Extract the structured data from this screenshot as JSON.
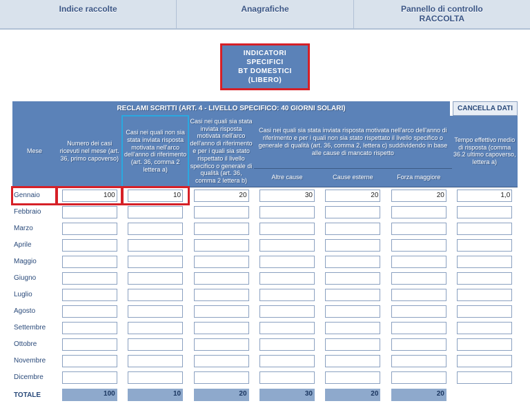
{
  "topbar": {
    "items": [
      "Indice raccolte",
      "Anagrafiche",
      "Pannello di controllo\nRACCOLTA"
    ]
  },
  "indicator_banner": {
    "line1": "INDICATORI SPECIFICI",
    "line2": "BT DOMESTICI (LIBERO)"
  },
  "title": "RECLAMI SCRITTI (ART. 4 - LIVELLO SPECIFICO: 40 GIORNI SOLARI)",
  "cancel_label": "CANCELLA DATI",
  "headers": {
    "mese": "Mese",
    "col1": "Numero dei casi ricevuti nel mese (art. 36, primo capoverso)",
    "col2": "Casi nei quali non sia stata inviata risposta motivata nell'arco dell'anno di riferimento (art. 36, comma 2 lettera a)",
    "col3": "Casi nei quali sia stata inviata risposta motivata nell'arco dell'anno di riferimento e per i quali sia stato rispettato il livello specifico o generale di qualità (art. 36, comma 2 lettera b)",
    "group4": "Casi nei quali sia stata inviata risposta motivata nell'arco dell'anno di riferimento e per i quali non sia stato rispettato il livello specifico o generale di qualità (art. 36, comma 2, lettera c) suddividendo in base alle cause di mancato rispetto",
    "col4a": "Altre cause",
    "col4b": "Cause esterne",
    "col4c": "Forza maggiore",
    "col5": "Tempo effettivo medio di risposta (comma 36.2 ultimo capoverso, lettera a)"
  },
  "months": [
    "Gennaio",
    "Febbraio",
    "Marzo",
    "Aprile",
    "Maggio",
    "Giugno",
    "Luglio",
    "Agosto",
    "Settembre",
    "Ottobre",
    "Novembre",
    "Dicembre"
  ],
  "rows": [
    {
      "v": [
        "100",
        "10",
        "20",
        "30",
        "20",
        "20",
        "1,0"
      ]
    },
    {
      "v": [
        "",
        "",
        "",
        "",
        "",
        "",
        ""
      ]
    },
    {
      "v": [
        "",
        "",
        "",
        "",
        "",
        "",
        ""
      ]
    },
    {
      "v": [
        "",
        "",
        "",
        "",
        "",
        "",
        ""
      ]
    },
    {
      "v": [
        "",
        "",
        "",
        "",
        "",
        "",
        ""
      ]
    },
    {
      "v": [
        "",
        "",
        "",
        "",
        "",
        "",
        ""
      ]
    },
    {
      "v": [
        "",
        "",
        "",
        "",
        "",
        "",
        ""
      ]
    },
    {
      "v": [
        "",
        "",
        "",
        "",
        "",
        "",
        ""
      ]
    },
    {
      "v": [
        "",
        "",
        "",
        "",
        "",
        "",
        ""
      ]
    },
    {
      "v": [
        "",
        "",
        "",
        "",
        "",
        "",
        ""
      ]
    },
    {
      "v": [
        "",
        "",
        "",
        "",
        "",
        "",
        ""
      ]
    },
    {
      "v": [
        "",
        "",
        "",
        "",
        "",
        "",
        ""
      ]
    }
  ],
  "totals": {
    "label": "TOTALE",
    "v": [
      "100",
      "10",
      "20",
      "30",
      "20",
      "20",
      ""
    ]
  }
}
